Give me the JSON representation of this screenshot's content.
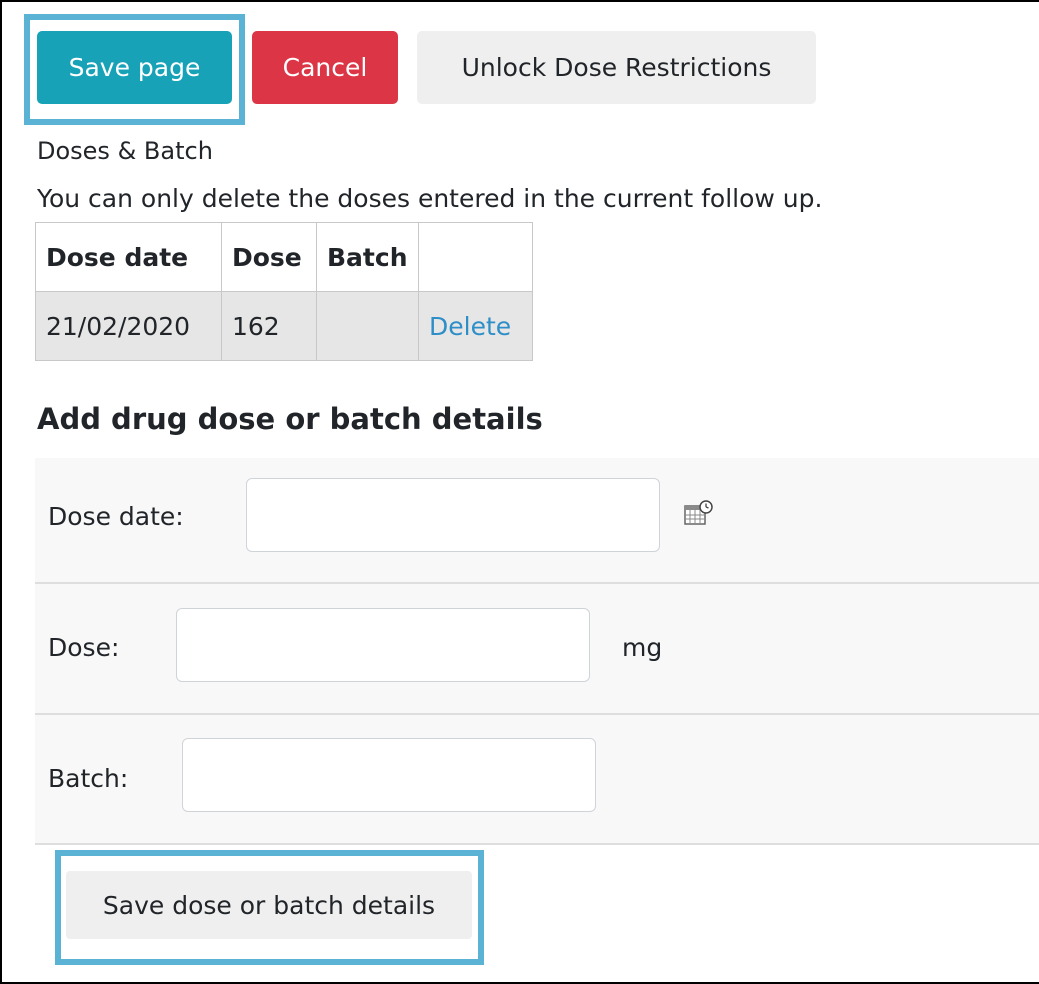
{
  "toolbar": {
    "save_label": "Save page",
    "cancel_label": "Cancel",
    "unlock_label": "Unlock Dose Restrictions"
  },
  "doses_section": {
    "heading": "Doses & Batch",
    "note": "You can only delete the doses entered in the current follow up.",
    "columns": [
      "Dose date",
      "Dose",
      "Batch",
      ""
    ],
    "rows": [
      {
        "dose_date": "21/02/2020",
        "dose": "162",
        "batch": "",
        "action": "Delete"
      }
    ]
  },
  "add_form": {
    "title": "Add drug dose or batch details",
    "dose_date_label": "Dose date:",
    "dose_date_value": "",
    "dose_label": "Dose:",
    "dose_value": "",
    "dose_unit": "mg",
    "batch_label": "Batch:",
    "batch_value": "",
    "calendar_icon": "calendar-icon",
    "submit_label": "Save dose or batch details"
  },
  "colors": {
    "primary": "#17a2b8",
    "danger": "#dc3545",
    "secondary_bg": "#efefef",
    "highlight": "#5ab3d4",
    "link": "#2e8fc8"
  }
}
